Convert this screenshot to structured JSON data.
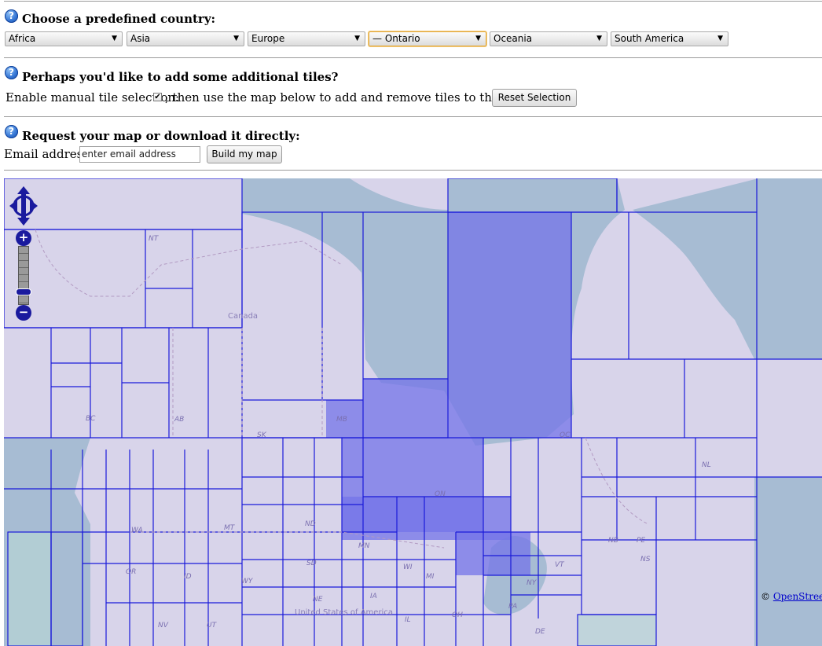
{
  "section_country": {
    "help": "?",
    "heading": "Choose a predefined country:",
    "selects": [
      {
        "label": "Africa"
      },
      {
        "label": "Asia"
      },
      {
        "label": "Europe"
      },
      {
        "label": "— Ontario"
      },
      {
        "label": "Oceania"
      },
      {
        "label": "South America"
      }
    ],
    "arrow": "▼"
  },
  "section_tiles": {
    "help": "?",
    "heading": "Perhaps you'd like to add some additional tiles?",
    "enable_label": "Enable manual tile selection:",
    "checkbox_checked": true,
    "checkbox_mark": "✔",
    "after_text": ", then use the map below to add and remove tiles to the selection.",
    "reset_label": "Reset Selection"
  },
  "section_request": {
    "help": "?",
    "heading": "Request your map or download it directly:",
    "email_label": "Email address:",
    "email_placeholder": "enter email address",
    "build_label": "Build my map"
  },
  "map": {
    "attribution_prefix": "© ",
    "attribution_link": "OpenStreetMap",
    "country_labels": [
      "Canada",
      "United States of America"
    ],
    "region_labels": [
      "NT",
      "BC",
      "AB",
      "SK",
      "MB",
      "ON",
      "QC",
      "NL",
      "WA",
      "MT",
      "ND",
      "MN",
      "WI",
      "MI",
      "NY",
      "VT",
      "NB",
      "PE",
      "NS",
      "OR",
      "ID",
      "WY",
      "SD",
      "NE",
      "IA",
      "IL",
      "OH",
      "PA",
      "NV",
      "UT",
      "DE"
    ],
    "colors": {
      "land": "#d8d4ea",
      "water": "#a7bcd3",
      "tile_border": "#1a1ad9",
      "selected_fill": "#7474e8",
      "nav_control": "#1a1a9e"
    },
    "zoom_in": "+",
    "zoom_out": "−"
  }
}
